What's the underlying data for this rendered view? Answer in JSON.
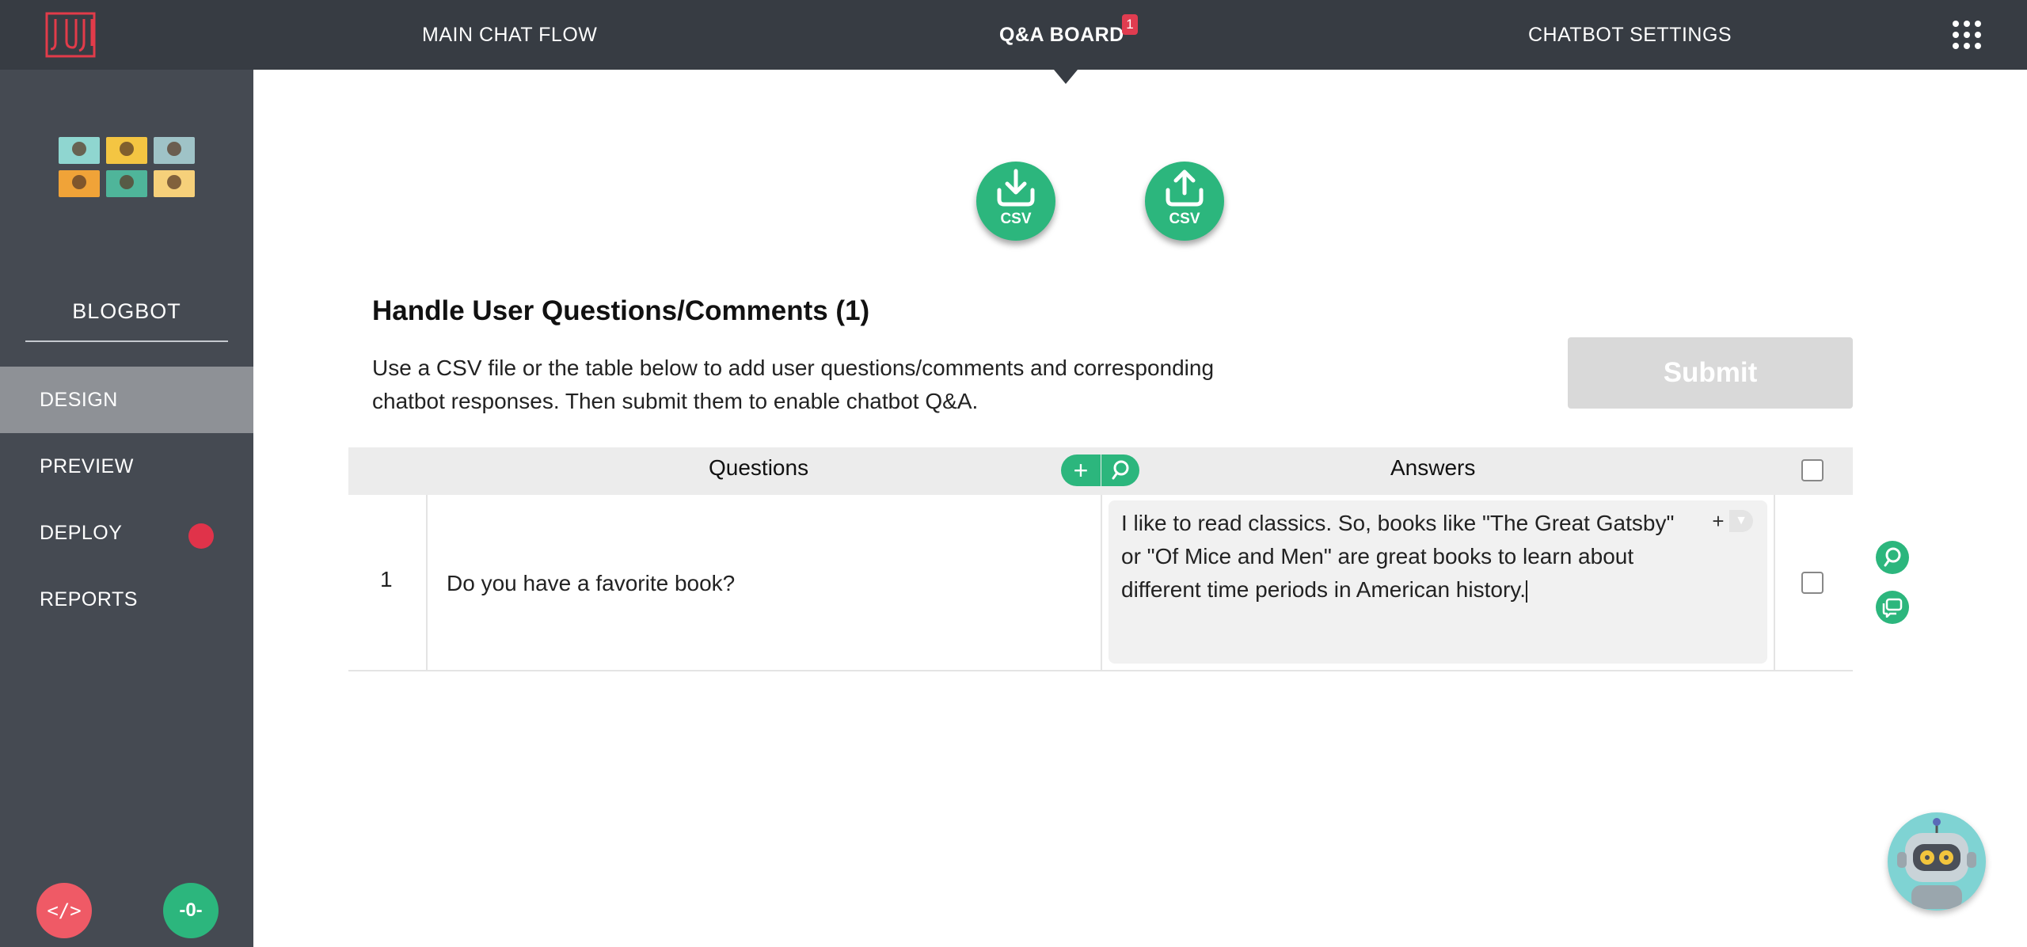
{
  "top_nav": {
    "main_chat_flow": "MAIN CHAT FLOW",
    "qa_board": "Q&A BOARD",
    "qa_board_badge": "1",
    "chatbot_settings": "CHATBOT SETTINGS",
    "logo_icon": "juji-logo",
    "apps_icon": "apps-grid-icon"
  },
  "sidebar": {
    "bot_name": "BLOGBOT",
    "items": [
      {
        "label": "DESIGN",
        "active": true
      },
      {
        "label": "PREVIEW",
        "active": false
      },
      {
        "label": "DEPLOY",
        "active": false,
        "status_dot": "#e0334a"
      },
      {
        "label": "REPORTS",
        "active": false
      }
    ],
    "code_button": "</>",
    "zero_button": "-0-"
  },
  "csv": {
    "download_label": "CSV",
    "upload_label": "CSV"
  },
  "qa": {
    "title": "Handle User Questions/Comments (1)",
    "description": "Use a CSV file or the table below to add user questions/comments and corresponding chatbot responses. Then submit them to enable chatbot Q&A.",
    "submit_label": "Submit",
    "columns": {
      "questions": "Questions",
      "answers": "Answers"
    },
    "rows": [
      {
        "number": "1",
        "question": "Do you have a favorite book?",
        "answer": "I like to read classics. So, books like \"The Great Gatsby\" or \"Of Mice and Men\" are great books to learn about different time periods in American history."
      }
    ]
  },
  "colors": {
    "topbar": "#373c43",
    "sidebar": "#454a52",
    "accent_green": "#2cb67d",
    "alert_red": "#e0334a",
    "submit_disabled": "#d9d9d9"
  }
}
